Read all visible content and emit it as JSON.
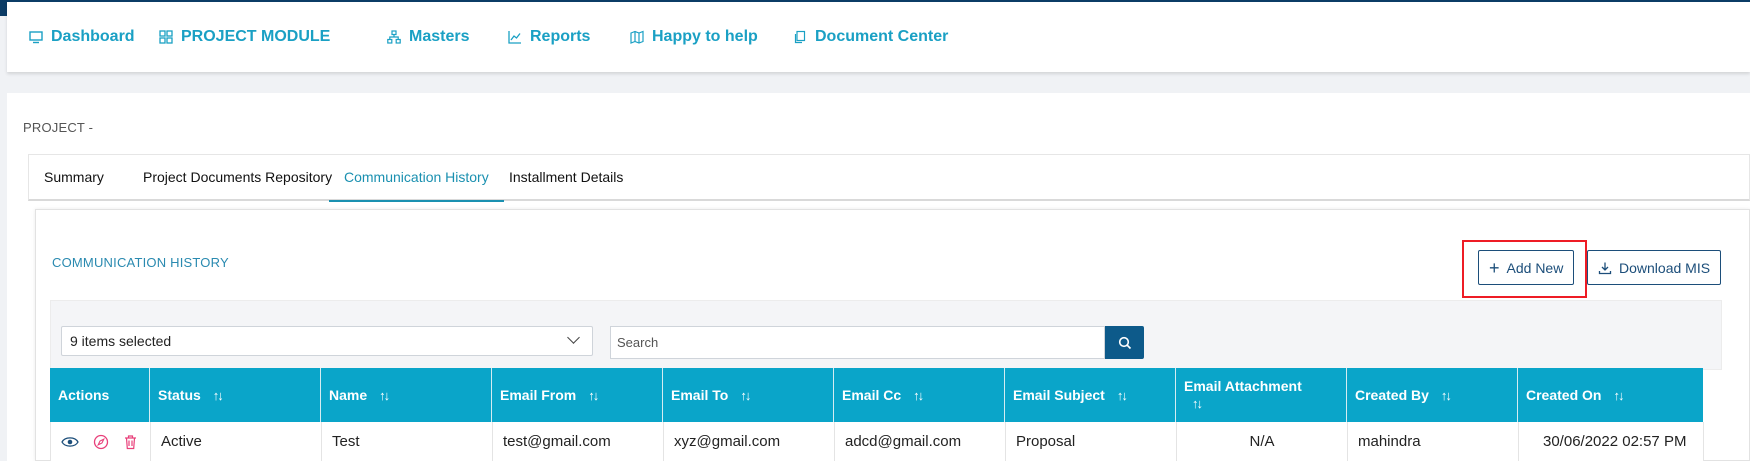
{
  "nav": {
    "items": [
      {
        "label": "Dashboard",
        "icon": "monitor-icon"
      },
      {
        "label": "PROJECT MODULE",
        "icon": "grid-icon"
      },
      {
        "label": "Masters",
        "icon": "sitemap-icon"
      },
      {
        "label": "Reports",
        "icon": "chart-line-icon"
      },
      {
        "label": "Happy to help",
        "icon": "map-icon"
      },
      {
        "label": "Document Center",
        "icon": "documents-icon"
      }
    ]
  },
  "project_label": "PROJECT -",
  "tabs": [
    {
      "label": "Summary"
    },
    {
      "label": "Project Documents Repository"
    },
    {
      "label": "Communication History",
      "active": true
    },
    {
      "label": "Installment Details"
    }
  ],
  "panel": {
    "title": "COMMUNICATION HISTORY",
    "add_new": "Add New",
    "download_mis": "Download MIS"
  },
  "filter": {
    "selected": "9 items selected",
    "search_placeholder": "Search"
  },
  "table": {
    "columns": [
      "Actions",
      "Status",
      "Name",
      "Email From",
      "Email To",
      "Email Cc",
      "Email Subject",
      "Email Attachment",
      "Created By",
      "Created On"
    ],
    "rows": [
      {
        "status": "Active",
        "name": "Test",
        "email_from": "test@gmail.com",
        "email_to": "xyz@gmail.com",
        "email_cc": "adcd@gmail.com",
        "subject": "Proposal",
        "attachment": "N/A",
        "created_by": "mahindra",
        "created_on": "30/06/2022 02:57 PM"
      }
    ]
  },
  "colors": {
    "accent": "#1aa0c4",
    "header_bg": "#0aa5c9",
    "primary_dark": "#0d5a8a",
    "highlight": "#ee1c25"
  }
}
